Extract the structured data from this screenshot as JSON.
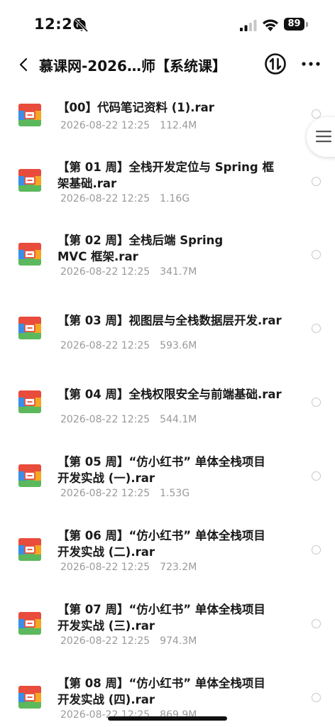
{
  "status_bar": {
    "time": "12:26",
    "battery": "89",
    "icons": [
      "bell-slash-icon",
      "signal-icon",
      "wifi-icon",
      "battery-icon"
    ]
  },
  "nav": {
    "title": "慕课网-2026…师【系统课】",
    "back_icon": "chevron-left-icon",
    "sort_icon": "sort-icon",
    "more_icon": "more-horizontal-icon"
  },
  "files": [
    {
      "name": "【00】代码笔记资料 (1).rar",
      "date": "2026-08-22 12:25",
      "size": "112.4M"
    },
    {
      "name": "【第 01 周】全栈开发定位与 Spring 框架基础.rar",
      "date": "2026-08-22 12:25",
      "size": "1.16G"
    },
    {
      "name": "【第 02 周】全栈后端 Spring MVC 框架.rar",
      "date": "2026-08-22 12:25",
      "size": "341.7M"
    },
    {
      "name": "【第 03 周】视图层与全栈数据层开发.rar",
      "date": "2026-08-22 12:25",
      "size": "593.6M"
    },
    {
      "name": "【第 04 周】全栈权限安全与前端基础.rar",
      "date": "2026-08-22 12:25",
      "size": "544.1M"
    },
    {
      "name": "【第 05 周】“仿小红书” 单体全栈项目开发实战 (一).rar",
      "date": "2026-08-22 12:25",
      "size": "1.53G"
    },
    {
      "name": "【第 06 周】“仿小红书” 单体全栈项目开发实战 (二).rar",
      "date": "2026-08-22 12:25",
      "size": "723.2M"
    },
    {
      "name": "【第 07 周】“仿小红书” 单体全栈项目开发实战 (三).rar",
      "date": "2026-08-22 12:25",
      "size": "974.3M"
    },
    {
      "name": "【第 08 周】“仿小红书” 单体全栈项目开发实战 (四).rar",
      "date": "2026-08-22 12:25",
      "size": "869.9M"
    }
  ],
  "colors": {
    "archive_top": "#e94b3c",
    "archive_left": "#3a8ee6",
    "archive_right": "#f5a623",
    "archive_bottom": "#5cb85c",
    "meta_text": "#9a9a9a"
  }
}
